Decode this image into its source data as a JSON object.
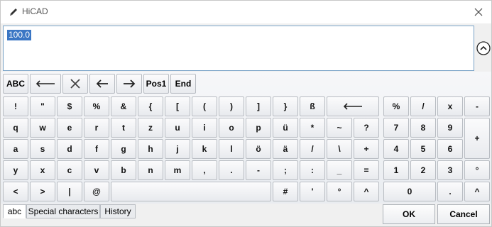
{
  "window": {
    "title": "HiCAD"
  },
  "input": {
    "value": "100.0"
  },
  "toolbar": {
    "abc_label": "ABC",
    "pos1_label": "Pos1",
    "end_label": "End"
  },
  "keys": {
    "r1": [
      "!",
      "\"",
      "$",
      "%",
      "&",
      "{",
      "[",
      "(",
      ")",
      "]",
      "}",
      "ß"
    ],
    "r2": [
      "q",
      "w",
      "e",
      "r",
      "t",
      "z",
      "u",
      "i",
      "o",
      "p",
      "ü",
      "*",
      "~",
      "?"
    ],
    "r3": [
      "a",
      "s",
      "d",
      "f",
      "g",
      "h",
      "j",
      "k",
      "l",
      "ö",
      "ä",
      "/",
      "\\",
      "+"
    ],
    "r4": [
      "y",
      "x",
      "c",
      "v",
      "b",
      "n",
      "m",
      ",",
      ".",
      "-",
      ";",
      ":",
      "_",
      "="
    ],
    "r5": [
      "<",
      ">",
      "|",
      "@",
      "#",
      "'",
      "°",
      "^"
    ],
    "num1": [
      "%",
      "/",
      "x",
      "-"
    ],
    "num2": [
      "7",
      "8",
      "9",
      "+"
    ],
    "num3": [
      "4",
      "5",
      "6"
    ],
    "num4": [
      "1",
      "2",
      "3",
      "°"
    ],
    "num5": [
      "0",
      ".",
      "^"
    ]
  },
  "tabs": [
    "abc",
    "Special characters",
    "History"
  ],
  "buttons": {
    "ok": "OK",
    "cancel": "Cancel"
  }
}
